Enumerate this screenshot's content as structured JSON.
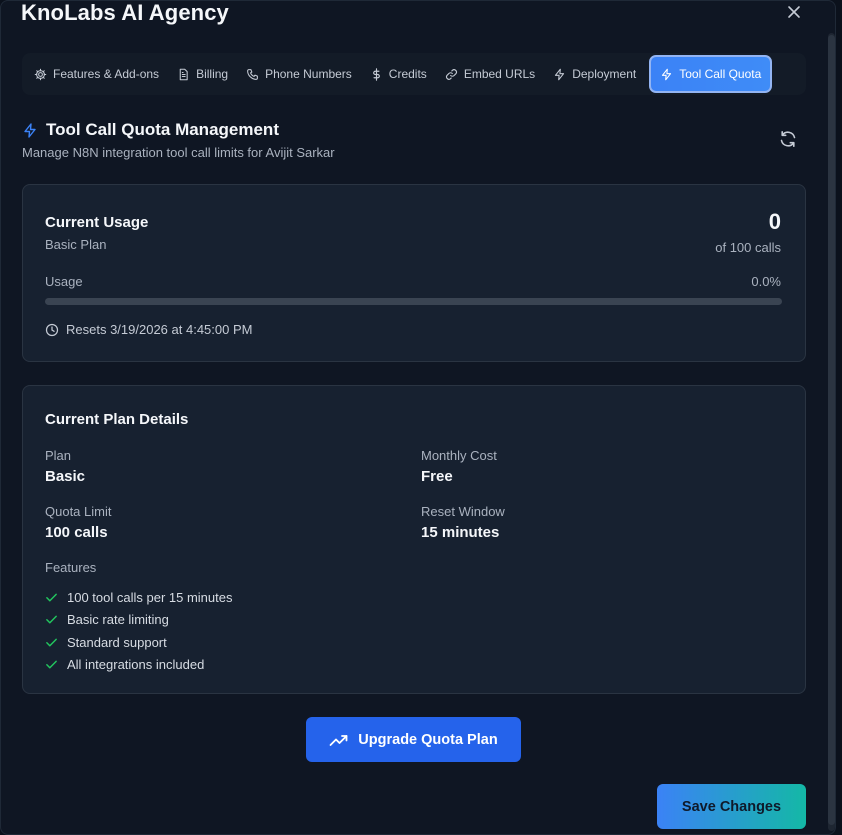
{
  "dialog": {
    "title": "KnoLabs AI Agency"
  },
  "tabs": [
    {
      "label": "Features & Add-ons",
      "icon": "gear-icon"
    },
    {
      "label": "Billing",
      "icon": "document-icon"
    },
    {
      "label": "Phone Numbers",
      "icon": "phone-icon"
    },
    {
      "label": "Credits",
      "icon": "dollar-icon"
    },
    {
      "label": "Embed URLs",
      "icon": "link-icon"
    },
    {
      "label": "Deployment",
      "icon": "lightning-icon"
    },
    {
      "label": "Tool Call Quota",
      "icon": "lightning-icon",
      "active": true
    }
  ],
  "section": {
    "title": "Tool Call Quota Management",
    "subtitle": "Manage N8N integration tool call limits for Avijit Sarkar"
  },
  "usage": {
    "title": "Current Usage",
    "plan": "Basic Plan",
    "count": "0",
    "of_label": "of 100 calls",
    "usage_label": "Usage",
    "usage_percent_text": "0.0%",
    "usage_fraction": 0.0,
    "resets": "Resets 3/19/2026 at 4:45:00 PM"
  },
  "plan_details": {
    "title": "Current Plan Details",
    "plan_label": "Plan",
    "plan_value": "Basic",
    "cost_label": "Monthly Cost",
    "cost_value": "Free",
    "quota_label": "Quota Limit",
    "quota_value": "100 calls",
    "window_label": "Reset Window",
    "window_value": "15 minutes",
    "features_label": "Features",
    "features": [
      "100 tool calls per 15 minutes",
      "Basic rate limiting",
      "Standard support",
      "All integrations included"
    ]
  },
  "actions": {
    "upgrade_label": "Upgrade Quota Plan",
    "save_label": "Save Changes"
  },
  "colors": {
    "accent": "#3b82f6",
    "check": "#22c55e",
    "background": "#0f1623",
    "card": "#172130"
  }
}
